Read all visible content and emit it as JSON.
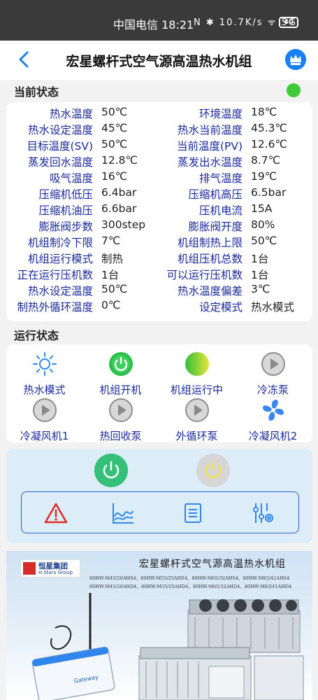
{
  "statusbar": {
    "carrier_time": "中国电信 18:21",
    "indicators": "N ✱ 10.7K/s ᯤ 5G",
    "battery": "40"
  },
  "appbar": {
    "title": "宏星螺杆式空气源高温热水机组",
    "back_icon": "chevron-left-icon",
    "crown_icon": "crown-icon"
  },
  "current_status": {
    "title": "当前状态",
    "indicator_color": "#3ecb36",
    "rows": [
      {
        "l1": "热水温度",
        "v1": "50℃",
        "l2": "环境温度",
        "v2": "18℃"
      },
      {
        "l1": "热水设定温度",
        "v1": "45℃",
        "l2": "热水当前温度",
        "v2": "45.3℃"
      },
      {
        "l1": "目标温度(SV)",
        "v1": "50℃",
        "l2": "当前温度(PV)",
        "v2": "12.6℃"
      },
      {
        "l1": "蒸发回水温度",
        "v1": "12.8℃",
        "l2": "蒸发出水温度",
        "v2": "8.7℃"
      },
      {
        "l1": "吸气温度",
        "v1": "16℃",
        "l2": "排气温度",
        "v2": "19℃"
      },
      {
        "l1": "压缩机低压",
        "v1": "6.4bar",
        "l2": "压缩机高压",
        "v2": "6.5bar"
      },
      {
        "l1": "压缩机油压",
        "v1": "6.6bar",
        "l2": "压机电流",
        "v2": "15A"
      },
      {
        "l1": "膨胀阀步数",
        "v1": "300step",
        "l2": "膨胀阀开度",
        "v2": "80%"
      },
      {
        "l1": "机组制冷下限",
        "v1": "7℃",
        "l2": "机组制热上限",
        "v2": "50℃"
      },
      {
        "l1": "机组运行模式",
        "v1": "制热",
        "l2": "机组压机总数",
        "v2": "1台"
      },
      {
        "l1": "正在运行压机数",
        "v1": "1台",
        "l2": "可以运行压机数",
        "v2": "1台"
      },
      {
        "l1": "热水设定温度",
        "v1": "50℃",
        "l2": "热水温度偏差",
        "v2": "3℃"
      },
      {
        "l1": "制热外循环温度",
        "v1": "0℃",
        "l2": "设定模式",
        "v2": "热水模式"
      }
    ]
  },
  "run_status": {
    "title": "运行状态",
    "items": [
      {
        "label": "热水模式",
        "icon": "sun-icon"
      },
      {
        "label": "机组开机",
        "icon": "power-on-icon"
      },
      {
        "label": "机组运行中",
        "icon": "running-indicator-icon"
      },
      {
        "label": "冷冻泵",
        "icon": "play-icon"
      },
      {
        "label": "冷凝风机1",
        "icon": "play-icon"
      },
      {
        "label": "热回收泵",
        "icon": "play-icon"
      },
      {
        "label": "外循环泵",
        "icon": "play-icon"
      },
      {
        "label": "冷凝风机2",
        "icon": "fan-icon"
      }
    ]
  },
  "controls": {
    "power_on_color": "#35c079",
    "power_off_color": "#d6d6d6",
    "tools": [
      "alarm-icon",
      "curve-chart-icon",
      "list-icon",
      "settings-sliders-icon"
    ]
  },
  "banner": {
    "logo_cn": "恒星集团",
    "logo_en": "H.Stars Group",
    "title": "宏星螺杆式空气源高温热水机组",
    "models_line1": "80HW-M45/20AHS4、80HW-M55/25AHS4、80HW-M65/32AHS4、80HW-M83/41AHS4",
    "models_line2": "80HW-M45/20AHD4、80HW-M55/25AHD4、80HW-M65/32AHD4、80HW-M83/41AHD4",
    "gateway_label": "Gateway"
  }
}
